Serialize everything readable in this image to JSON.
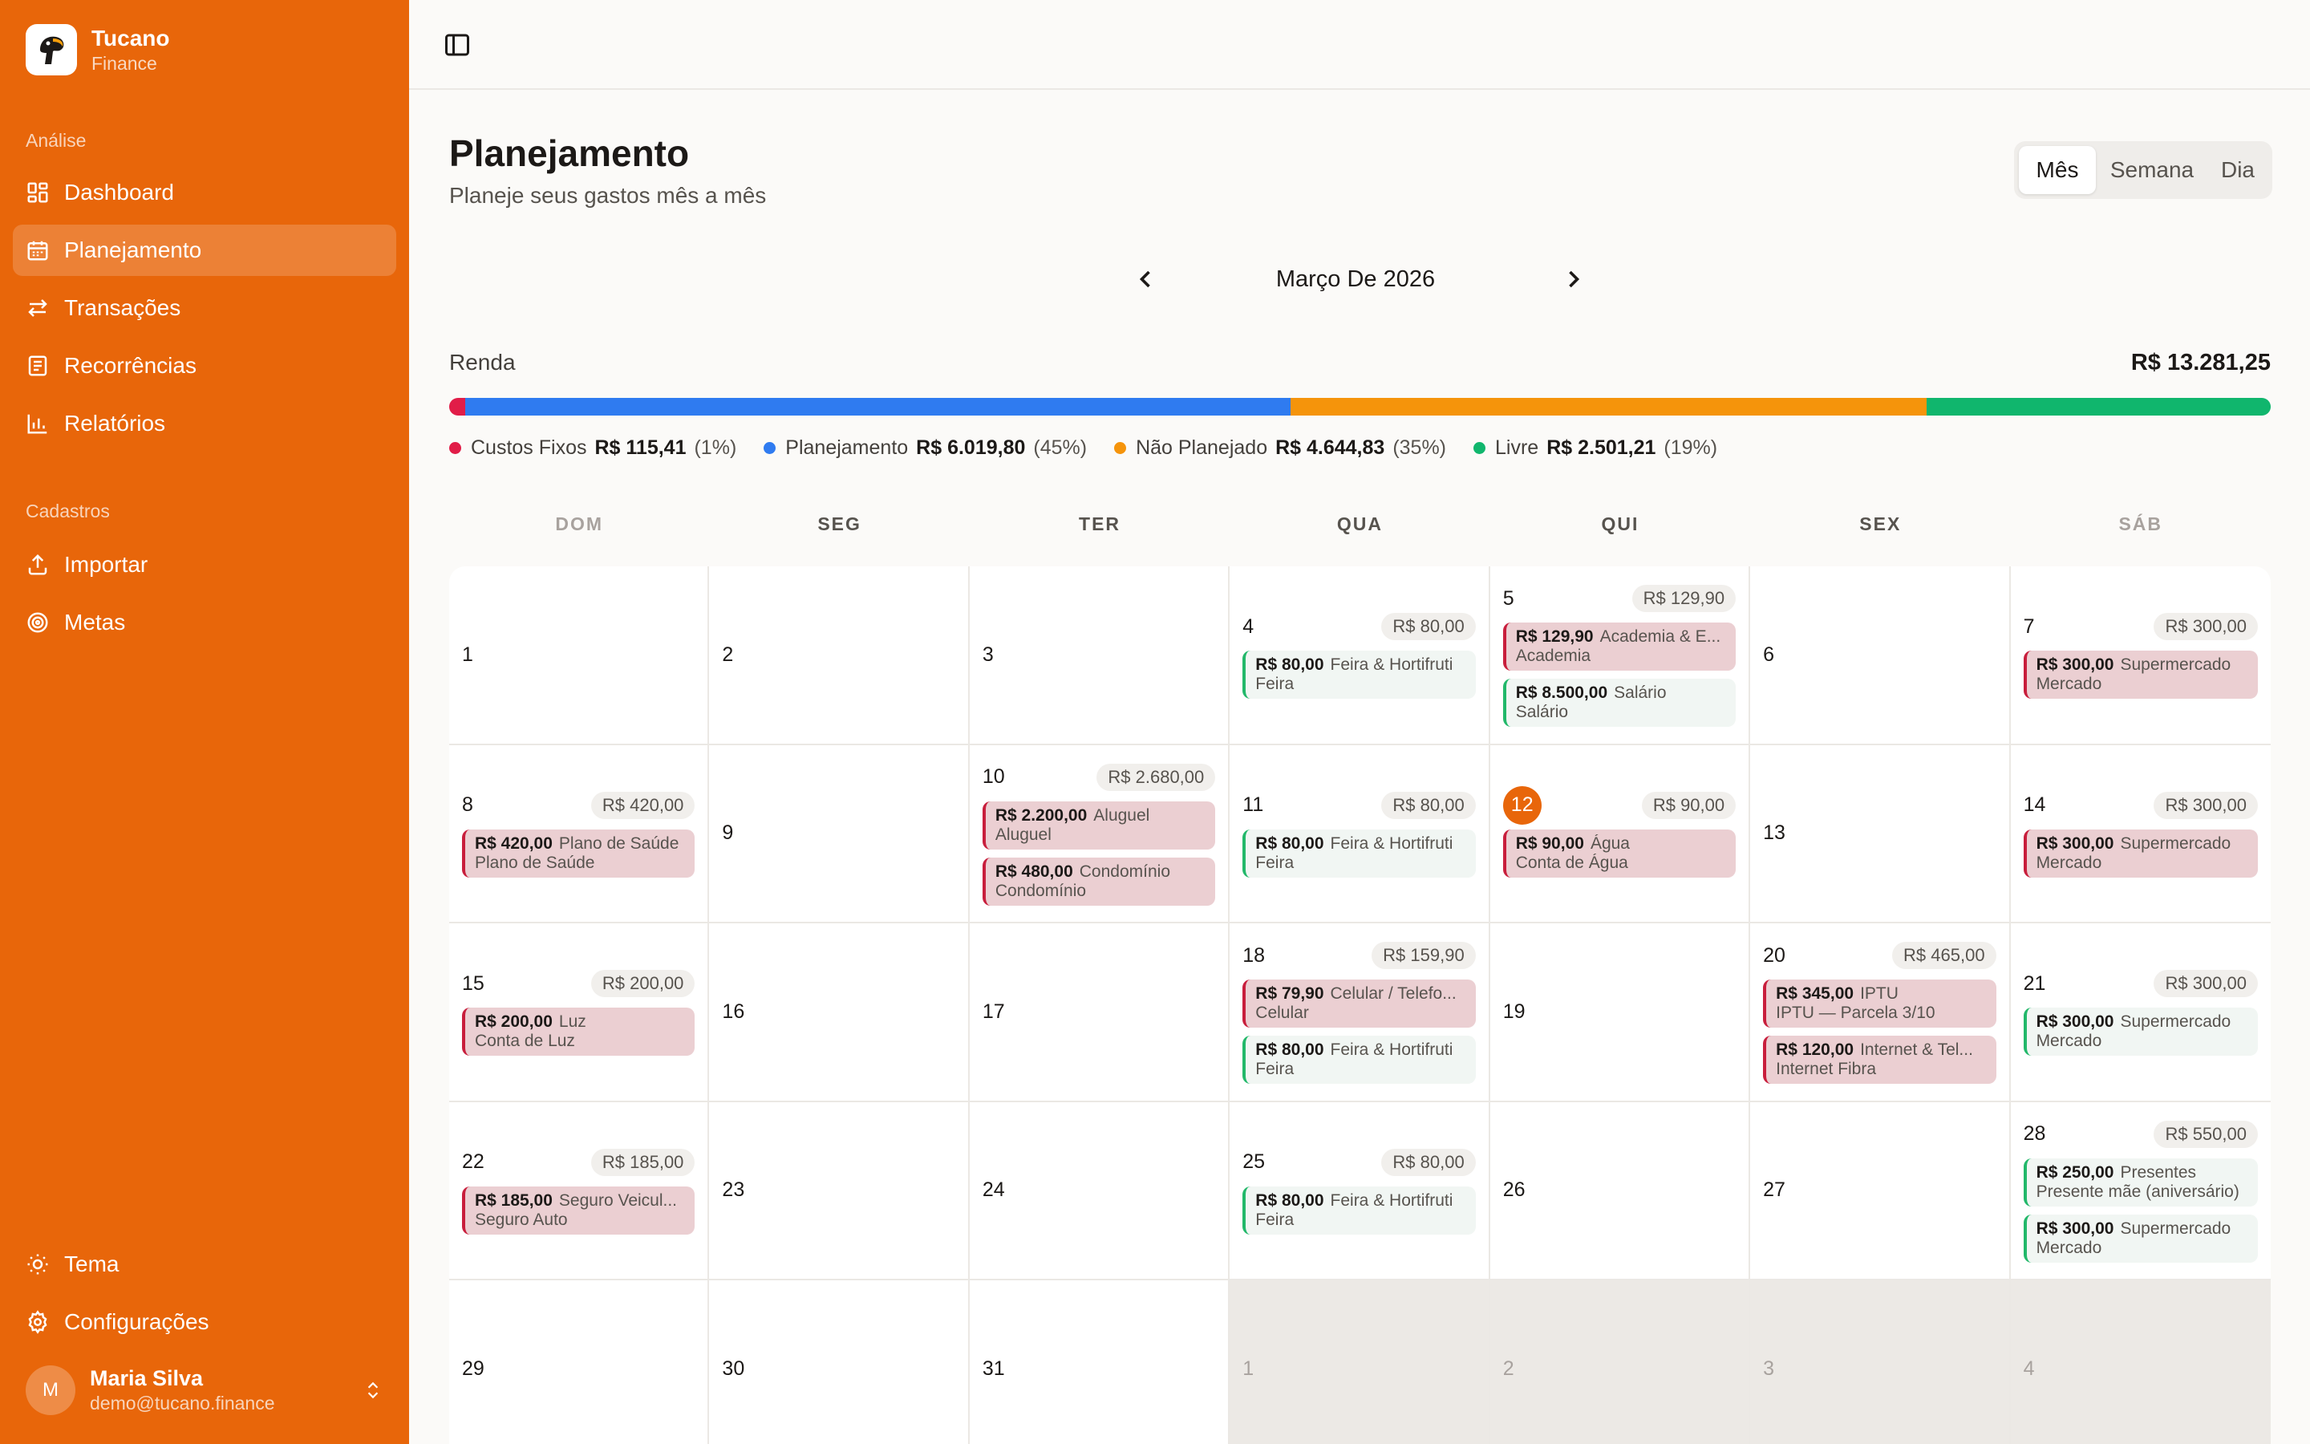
{
  "brand": {
    "name": "Tucano",
    "sub": "Finance"
  },
  "sidebar": {
    "analise_label": "Análise",
    "cadastros_label": "Cadastros",
    "items": [
      {
        "label": "Dashboard",
        "icon": "dashboard-icon"
      },
      {
        "label": "Planejamento",
        "icon": "calendar-icon",
        "active": true
      },
      {
        "label": "Transações",
        "icon": "transfer-icon"
      },
      {
        "label": "Recorrências",
        "icon": "recurring-icon"
      },
      {
        "label": "Relatórios",
        "icon": "chart-icon"
      }
    ],
    "cadastros": [
      {
        "label": "Importar",
        "icon": "upload-icon"
      },
      {
        "label": "Metas",
        "icon": "target-icon"
      }
    ],
    "bottom": [
      {
        "label": "Tema",
        "icon": "sun-icon"
      },
      {
        "label": "Configurações",
        "icon": "gear-icon"
      }
    ],
    "user": {
      "initial": "M",
      "name": "Maria Silva",
      "email": "demo@tucano.finance"
    }
  },
  "header": {
    "title": "Planejamento",
    "subtitle": "Planeje seus gastos mês a mês"
  },
  "view_switch": [
    "Mês",
    "Semana",
    "Dia"
  ],
  "month": "Março De 2026",
  "income": {
    "label": "Renda",
    "value": "R$ 13.281,25"
  },
  "budget": [
    {
      "name": "Custos Fixos",
      "amount": "R$ 115,41",
      "pct": "(1%)",
      "share": 0.9,
      "color": "#e11d48"
    },
    {
      "name": "Planejamento",
      "amount": "R$ 6.019,80",
      "pct": "(45%)",
      "share": 45.3,
      "color": "#2f7bf0"
    },
    {
      "name": "Não Planejado",
      "amount": "R$ 4.644,83",
      "pct": "(35%)",
      "share": 34.9,
      "color": "#f5940b"
    },
    {
      "name": "Livre",
      "amount": "R$ 2.501,21",
      "pct": "(19%)",
      "share": 18.9,
      "color": "#10b66d"
    }
  ],
  "weekdays": [
    "DOM",
    "SEG",
    "TER",
    "QUA",
    "QUI",
    "SEX",
    "SÁB"
  ],
  "weeks": [
    [
      {
        "day": "1"
      },
      {
        "day": "2"
      },
      {
        "day": "3"
      },
      {
        "day": "4",
        "total": "R$ 80,00",
        "events": [
          {
            "amount": "R$ 80,00",
            "name": "Feira & Hortifruti",
            "sub": "Feira",
            "kind": "inc"
          }
        ]
      },
      {
        "day": "5",
        "total": "R$ 129,90",
        "events": [
          {
            "amount": "R$ 129,90",
            "name": "Academia & E...",
            "sub": "Academia",
            "kind": "exp"
          },
          {
            "amount": "R$ 8.500,00",
            "name": "Salário",
            "sub": "Salário",
            "kind": "inc"
          }
        ]
      },
      {
        "day": "6"
      },
      {
        "day": "7",
        "total": "R$ 300,00",
        "events": [
          {
            "amount": "R$ 300,00",
            "name": "Supermercado",
            "sub": "Mercado",
            "kind": "exp"
          }
        ]
      }
    ],
    [
      {
        "day": "8",
        "total": "R$ 420,00",
        "events": [
          {
            "amount": "R$ 420,00",
            "name": "Plano de Saúde",
            "sub": "Plano de Saúde",
            "kind": "exp"
          }
        ]
      },
      {
        "day": "9"
      },
      {
        "day": "10",
        "total": "R$ 2.680,00",
        "events": [
          {
            "amount": "R$ 2.200,00",
            "name": "Aluguel",
            "sub": "Aluguel",
            "kind": "exp"
          },
          {
            "amount": "R$ 480,00",
            "name": "Condomínio",
            "sub": "Condomínio",
            "kind": "exp"
          }
        ]
      },
      {
        "day": "11",
        "total": "R$ 80,00",
        "events": [
          {
            "amount": "R$ 80,00",
            "name": "Feira & Hortifruti",
            "sub": "Feira",
            "kind": "inc"
          }
        ]
      },
      {
        "day": "12",
        "today": true,
        "total": "R$ 90,00",
        "events": [
          {
            "amount": "R$ 90,00",
            "name": "Água",
            "sub": "Conta de Água",
            "kind": "exp"
          }
        ]
      },
      {
        "day": "13"
      },
      {
        "day": "14",
        "total": "R$ 300,00",
        "events": [
          {
            "amount": "R$ 300,00",
            "name": "Supermercado",
            "sub": "Mercado",
            "kind": "exp"
          }
        ]
      }
    ],
    [
      {
        "day": "15",
        "total": "R$ 200,00",
        "events": [
          {
            "amount": "R$ 200,00",
            "name": "Luz",
            "sub": "Conta de Luz",
            "kind": "exp"
          }
        ]
      },
      {
        "day": "16"
      },
      {
        "day": "17"
      },
      {
        "day": "18",
        "total": "R$ 159,90",
        "events": [
          {
            "amount": "R$ 79,90",
            "name": "Celular / Telefo...",
            "sub": "Celular",
            "kind": "exp"
          },
          {
            "amount": "R$ 80,00",
            "name": "Feira & Hortifruti",
            "sub": "Feira",
            "kind": "inc"
          }
        ]
      },
      {
        "day": "19"
      },
      {
        "day": "20",
        "total": "R$ 465,00",
        "events": [
          {
            "amount": "R$ 345,00",
            "name": "IPTU",
            "sub": "IPTU — Parcela 3/10",
            "kind": "exp"
          },
          {
            "amount": "R$ 120,00",
            "name": "Internet & Tel...",
            "sub": "Internet Fibra",
            "kind": "exp"
          }
        ]
      },
      {
        "day": "21",
        "total": "R$ 300,00",
        "events": [
          {
            "amount": "R$ 300,00",
            "name": "Supermercado",
            "sub": "Mercado",
            "kind": "inc"
          }
        ]
      }
    ],
    [
      {
        "day": "22",
        "total": "R$ 185,00",
        "events": [
          {
            "amount": "R$ 185,00",
            "name": "Seguro Veicul...",
            "sub": "Seguro Auto",
            "kind": "exp"
          }
        ]
      },
      {
        "day": "23"
      },
      {
        "day": "24"
      },
      {
        "day": "25",
        "total": "R$ 80,00",
        "events": [
          {
            "amount": "R$ 80,00",
            "name": "Feira & Hortifruti",
            "sub": "Feira",
            "kind": "inc"
          }
        ]
      },
      {
        "day": "26"
      },
      {
        "day": "27"
      },
      {
        "day": "28",
        "total": "R$ 550,00",
        "events": [
          {
            "amount": "R$ 250,00",
            "name": "Presentes",
            "sub": "Presente mãe (aniversário)",
            "kind": "inc"
          },
          {
            "amount": "R$ 300,00",
            "name": "Supermercado",
            "sub": "Mercado",
            "kind": "inc"
          }
        ]
      }
    ],
    [
      {
        "day": "29"
      },
      {
        "day": "30"
      },
      {
        "day": "31"
      },
      {
        "day": "1",
        "other": true
      },
      {
        "day": "2",
        "other": true
      },
      {
        "day": "3",
        "other": true
      },
      {
        "day": "4",
        "other": true
      }
    ]
  ]
}
